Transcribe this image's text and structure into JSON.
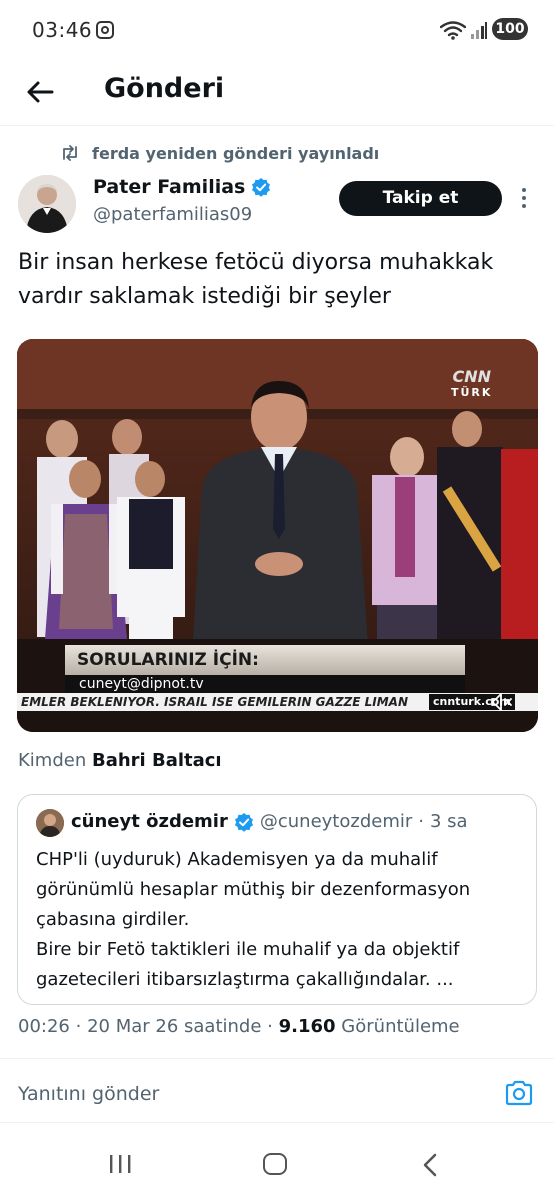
{
  "status_bar": {
    "time": "03:46",
    "battery": "100"
  },
  "header": {
    "title": "Gönderi"
  },
  "repost": {
    "text": "ferda yeniden gönderi yayınladı"
  },
  "author": {
    "name": "Pater Familias",
    "handle": "@paterfamilias09",
    "follow_label": "Takip et"
  },
  "post": {
    "text": "Bir insan herkese fetöcü diyorsa muhakkak vardır saklamak istediği bir şeyler"
  },
  "video": {
    "caption": "SORULARINIZ İÇİN:",
    "email": "cuneyt@dipnot.tv",
    "ticker": "EMLER BEKLENIYOR. ISRAIL ISE GEMILERIN GAZZE LIMAN",
    "site": "cnnturk.com",
    "channel_top": "CNN",
    "channel_bottom": "TÜRK"
  },
  "source": {
    "prefix": "Kimden",
    "name": "Bahri Baltacı"
  },
  "quote": {
    "name": "cüneyt özdemir",
    "handle": "@cuneytozdemir",
    "time": "3 sa",
    "line1": "CHP'li (uyduruk) Akademisyen ya da muhalif görünümlü hesaplar müthiş bir dezenformasyon çabasına girdiler.",
    "line2": "Bire bir Fetö taktikleri ile muhalif ya da objektif gazetecileri itibarsızlaştırma çakallığındalar. ..."
  },
  "meta": {
    "time": "00:26",
    "date": "20 Mar 26 saatinde",
    "views": "9.160",
    "views_label": "Görüntüleme"
  },
  "reply": {
    "placeholder": "Yanıtını gönder"
  },
  "colors": {
    "verified": "#1d9bf0",
    "text": "#0f1419",
    "muted": "#536471",
    "accent": "#1d9bf0"
  }
}
